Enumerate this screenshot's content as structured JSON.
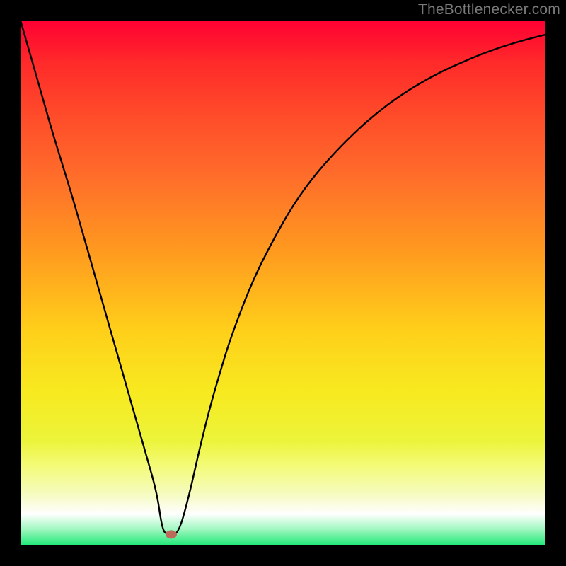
{
  "watermark": {
    "text": "TheBottlenecker.com"
  },
  "chart_data": {
    "type": "line",
    "title": "",
    "xlabel": "",
    "ylabel": "",
    "xlim": [
      0,
      100
    ],
    "ylim": [
      0,
      100
    ],
    "x": [
      0,
      2,
      4,
      6,
      8,
      10,
      12,
      14,
      16,
      18,
      20,
      22,
      24,
      26,
      27,
      28,
      30,
      32,
      34,
      36,
      38,
      40,
      44,
      48,
      52,
      56,
      60,
      64,
      68,
      72,
      76,
      80,
      84,
      88,
      92,
      96,
      100
    ],
    "values": [
      100,
      93,
      86,
      79,
      72.5,
      66,
      59,
      52,
      45,
      38,
      31,
      24,
      17,
      10,
      3,
      2,
      2,
      9,
      18,
      26,
      33,
      39.5,
      50,
      58,
      65,
      70.5,
      75,
      79,
      82.5,
      85.5,
      88,
      90.2,
      92,
      93.7,
      95.1,
      96.3,
      97.3
    ],
    "marker": {
      "x": 28.7,
      "y": 2.1
    },
    "gradient_stops": [
      {
        "pos": 0.0,
        "color": "#ff0033"
      },
      {
        "pos": 0.25,
        "color": "#ff5a28"
      },
      {
        "pos": 0.5,
        "color": "#ffb01a"
      },
      {
        "pos": 0.72,
        "color": "#f2ea20"
      },
      {
        "pos": 0.94,
        "color": "#ffffff"
      },
      {
        "pos": 1.0,
        "color": "#1ee878"
      }
    ]
  }
}
